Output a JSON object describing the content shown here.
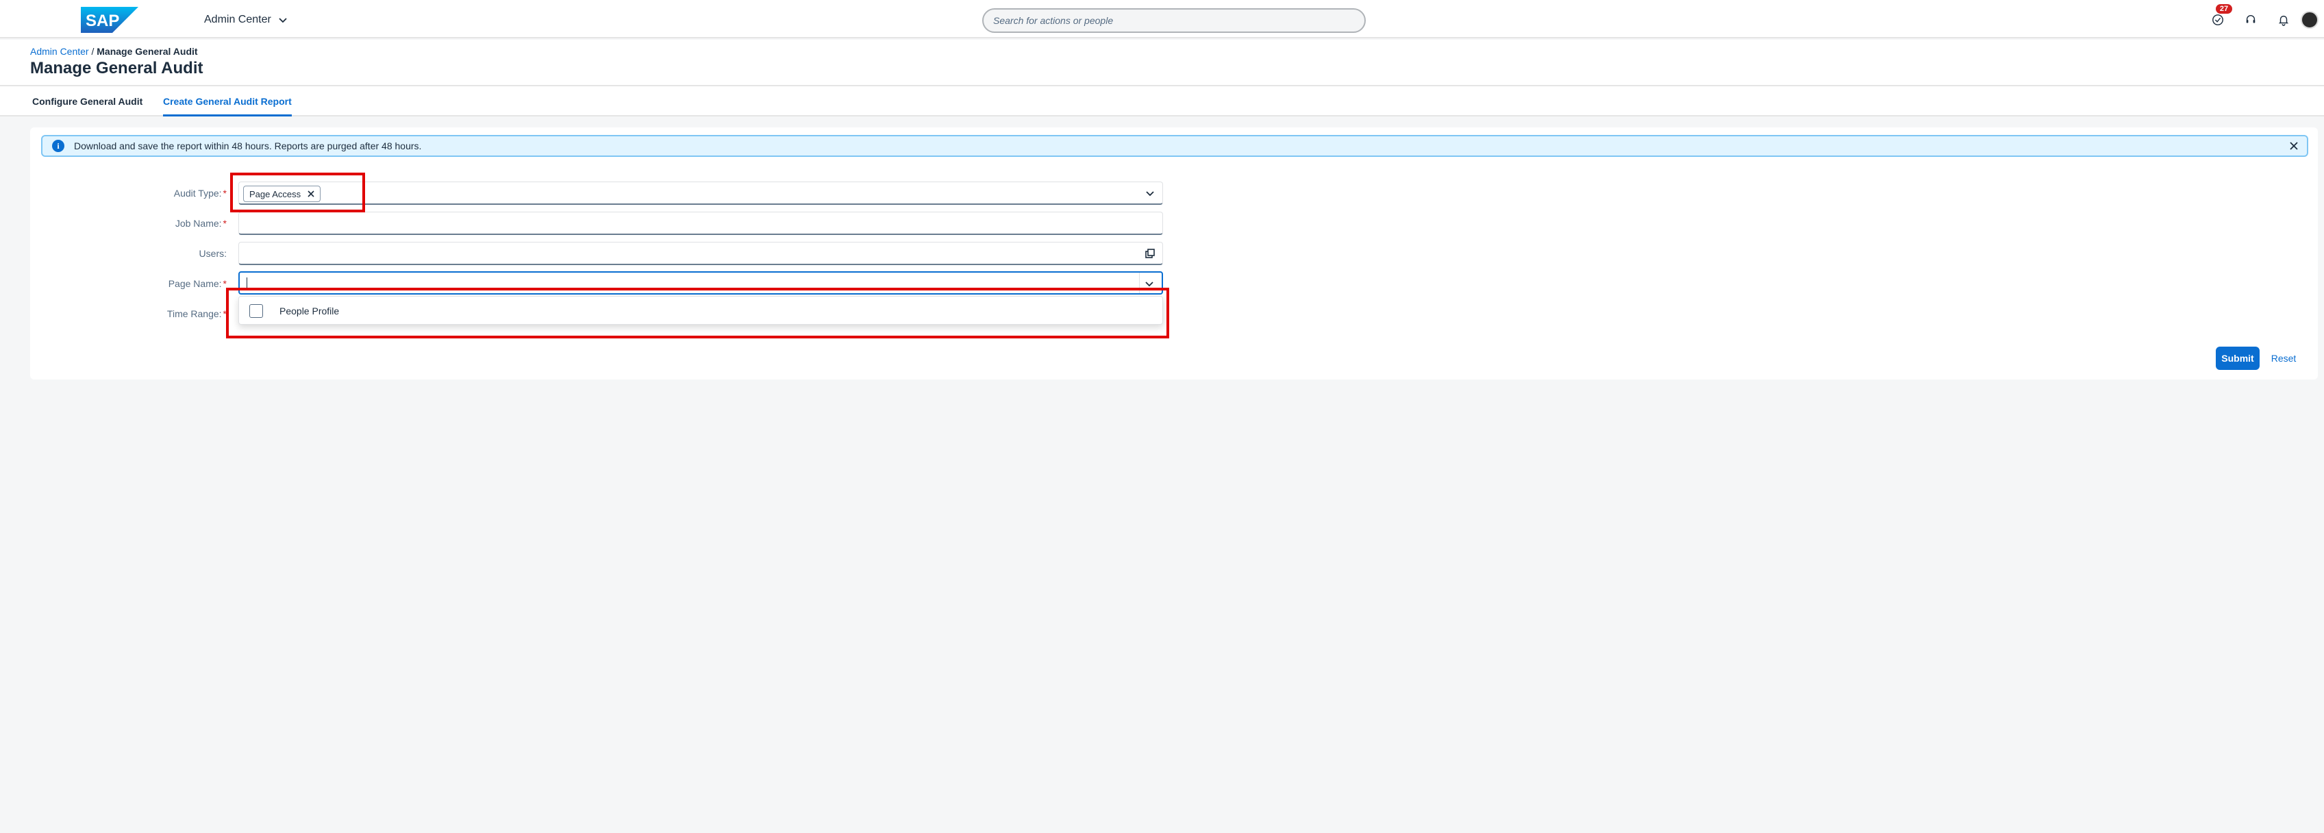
{
  "shellbar": {
    "logo_text": "SAP",
    "app_title": "Admin Center",
    "search_placeholder": "Search for actions or people",
    "notifications_count": "27"
  },
  "header": {
    "breadcrumb_link": "Admin Center",
    "breadcrumb_sep": " / ",
    "breadcrumb_current": "Manage General Audit",
    "title": "Manage General Audit"
  },
  "tabs": [
    {
      "label": "Configure General Audit",
      "active": false
    },
    {
      "label": "Create General Audit Report",
      "active": true
    }
  ],
  "banner": {
    "message": "Download and save the report within 48 hours. Reports are purged after 48 hours."
  },
  "form": {
    "audit_type": {
      "label": "Audit Type:",
      "required": "*",
      "token": "Page Access"
    },
    "job_name": {
      "label": "Job Name:",
      "required": "*",
      "value": ""
    },
    "users": {
      "label": "Users:",
      "value": ""
    },
    "page_name": {
      "label": "Page Name:",
      "required": "*",
      "value": ""
    },
    "time_range": {
      "label": "Time Range:",
      "required": "*"
    },
    "page_name_options": [
      {
        "label": "People Profile",
        "checked": false
      }
    ]
  },
  "actions": {
    "submit": "Submit",
    "reset": "Reset"
  },
  "colors": {
    "brand_blue": "#0a6ed1",
    "annotation_red": "#e00000",
    "info_bg": "#e1f4ff"
  }
}
